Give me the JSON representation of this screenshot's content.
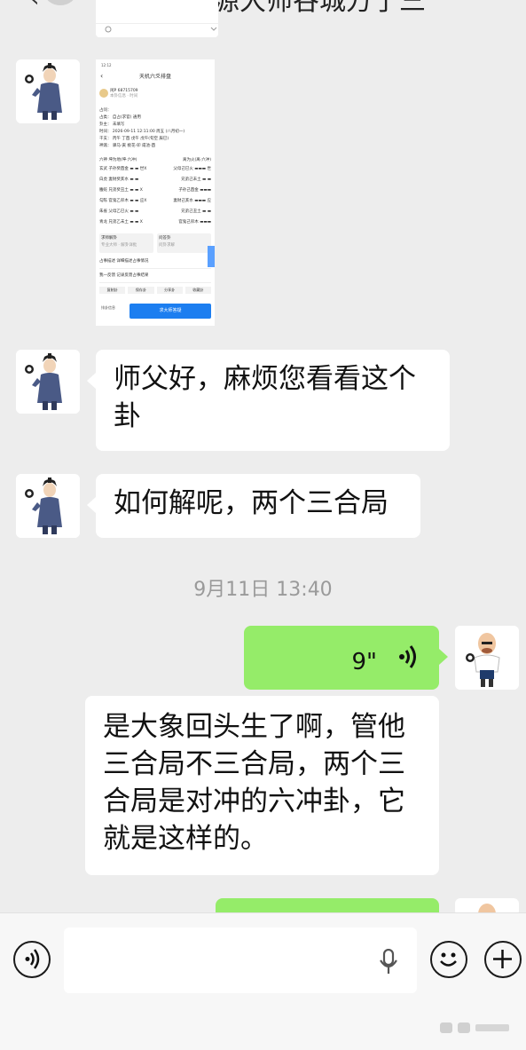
{
  "header": {
    "back_glyph": "‹",
    "title": "王小问源大师谷城方了三"
  },
  "thumbnail": {
    "status_time": "12:12",
    "title": "天机六爻排盘",
    "username": "闲P 68715709",
    "username_sub": "本卦信息 · 时间",
    "info_rows": [
      "占问：",
      "占类： 自占(求官) 通用",
      "卦主： 未填写",
      "时间： 2026-09-11 12:11:00 周五 (八月初一)",
      "干支： 丙午 丁酉 戊午 戊午(旬空 辰巳)",
      "神煞： 驿马-寅 桃花-卯 咸池-酉"
    ],
    "gua_header": [
      "六神 坤为地(坤·六冲)",
      "离为火(离·六冲)"
    ],
    "gua_rows": [
      [
        "玄武 子孙癸酉金 ▬ ▬ 世X",
        "父母己巳火 ▬▬▬ 世"
      ],
      [
        "白虎 妻财癸亥水 ▬ ▬",
        "兄弟己未土 ▬ ▬"
      ],
      [
        "螣蛇 兄弟癸丑土 ▬ ▬ X",
        "子孙己酉金 ▬▬▬"
      ],
      [
        "勾陈 官鬼乙卯木 ▬ ▬ 应X",
        "妻财己亥水 ▬▬▬ 应"
      ],
      [
        "朱雀 父母乙巳火 ▬ ▬",
        "兄弟己丑土 ▬ ▬"
      ],
      [
        "青龙 兄弟乙未土 ▬ ▬ X",
        "官鬼己卯木 ▬▬▬"
      ]
    ],
    "cards": [
      {
        "title": "求师解卦",
        "sub": "专业大师 · 解卦详批"
      },
      {
        "title": "问答卦",
        "sub": "问卦求解"
      }
    ],
    "lines": [
      "占事描述  详细描述占事情况",
      "我一反馈  记录反馈占事结果"
    ],
    "chips": [
      "复制卦",
      "保存卦",
      "分享卦",
      "收藏卦"
    ],
    "side_label": "排卦信息",
    "button": "求大师答疑"
  },
  "messages": {
    "msg1": [
      "师父好，麻烦您看看这个",
      "卦"
    ],
    "msg2": [
      "如何解呢，两个三合局"
    ],
    "timestamp": "9月11日 13:40",
    "voice_duration": "9\"",
    "msg3": [
      "是大象回头生了啊，管他",
      "三合局不三合局，两个三",
      "合局是对冲的六冲卦，它",
      "就是这样的。"
    ]
  },
  "inputbar": {
    "voice_icon": "voice-toggle-icon",
    "emoji_icon": "emoji-icon",
    "plus_icon": "plus-icon",
    "input_value": ""
  },
  "colors": {
    "background": "#ededed",
    "green_bubble": "#95ec69",
    "white_bubble": "#ffffff",
    "button_blue": "#1c7ef0"
  }
}
